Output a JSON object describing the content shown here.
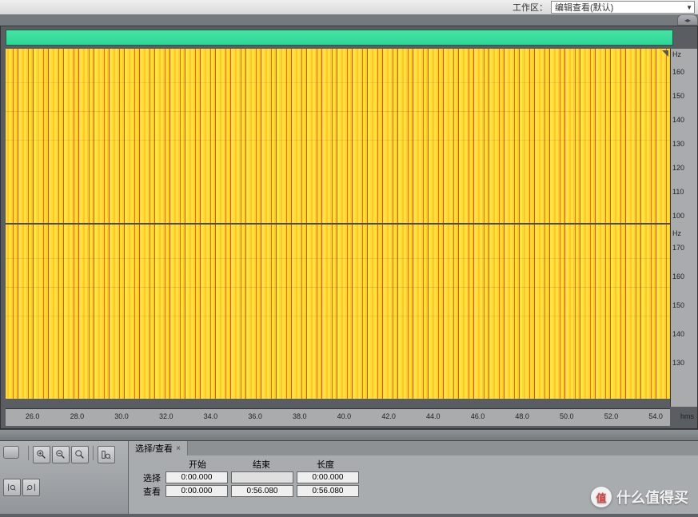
{
  "topbar": {
    "workspace_label": "工作区：",
    "workspace_value": "编辑查看(默认)"
  },
  "time_axis": {
    "ticks": [
      "26.0",
      "28.0",
      "30.0",
      "32.0",
      "34.0",
      "36.0",
      "38.0",
      "40.0",
      "42.0",
      "44.0",
      "46.0",
      "48.0",
      "50.0",
      "52.0",
      "54.0"
    ],
    "unit": "hms"
  },
  "freq_axis": {
    "unit": "Hz",
    "ch1_ticks": [
      "160",
      "150",
      "140",
      "130",
      "120",
      "110",
      "100"
    ],
    "ch2_ticks": [
      "170",
      "160",
      "150",
      "140",
      "130"
    ]
  },
  "panel": {
    "tab_label": "选择/查看",
    "columns": {
      "start": "开始",
      "end": "结束",
      "length": "长度"
    },
    "rows": {
      "select": {
        "label": "选择",
        "start": "0:00.000",
        "end": "",
        "length": "0:00.000"
      },
      "view": {
        "label": "查看",
        "start": "0:00.000",
        "end": "0:56.080",
        "length": "0:56.080"
      }
    }
  },
  "watermark": {
    "badge": "值",
    "text": "什么值得买"
  }
}
